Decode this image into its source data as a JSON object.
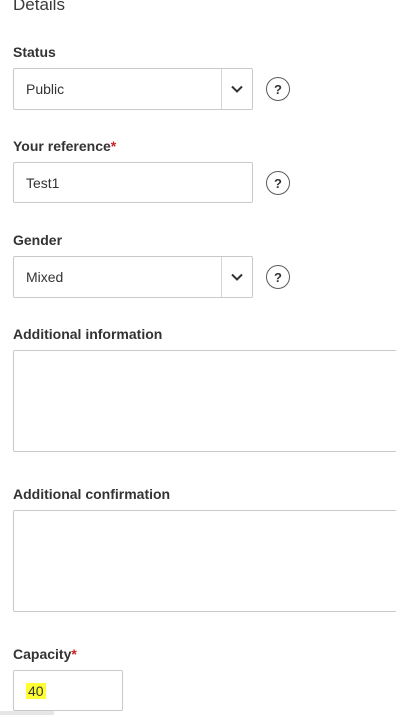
{
  "section": {
    "title": "Details"
  },
  "status": {
    "label": "Status",
    "value": "Public",
    "help": "?"
  },
  "reference": {
    "label": "Your reference",
    "required_marker": "*",
    "value": "Test1",
    "help": "?"
  },
  "gender": {
    "label": "Gender",
    "value": "Mixed",
    "help": "?"
  },
  "additional_information": {
    "label": "Additional information",
    "value": ""
  },
  "additional_confirmation": {
    "label": "Additional confirmation",
    "value": ""
  },
  "capacity": {
    "label": "Capacity",
    "required_marker": "*",
    "value": "40",
    "highlight_color": "#ffff33"
  },
  "icons": {
    "select_arrow": "chevron-down-icon",
    "help": "question-mark-icon"
  },
  "colors": {
    "required": "#cc2222",
    "border": "#c9c9c9",
    "text": "#333333"
  }
}
